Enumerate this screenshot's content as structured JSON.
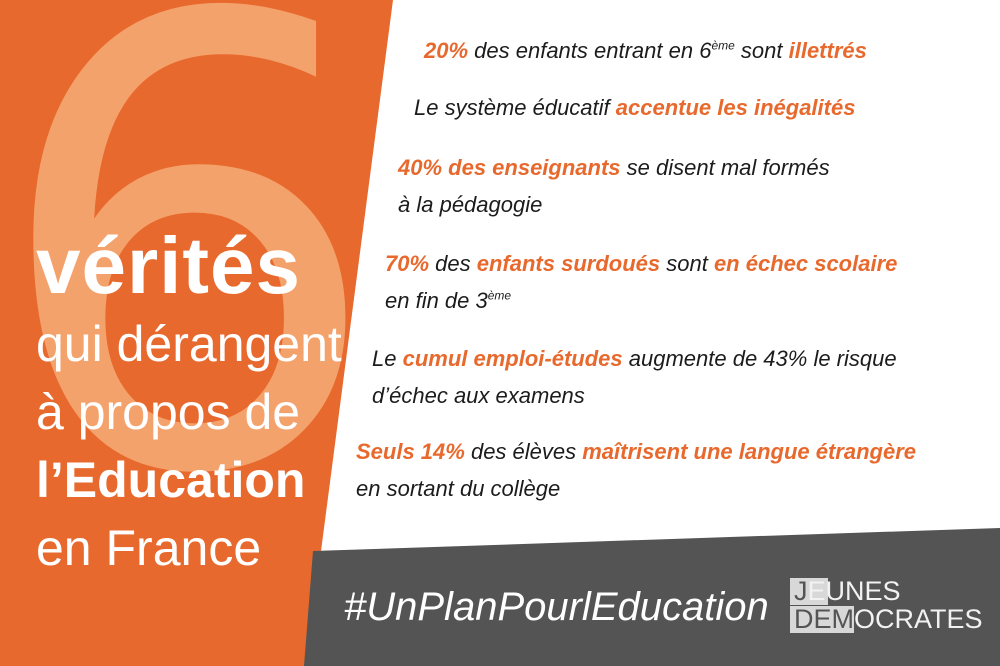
{
  "colors": {
    "orange": "#e8692d",
    "light_orange": "#f4a26c",
    "dark_grey": "#545454",
    "white": "#ffffff"
  },
  "big_number": "6",
  "left": {
    "line1": "vérités",
    "line2": "qui dérangent",
    "line3": "à propos de",
    "line4": "l’Education",
    "line5": "en France"
  },
  "facts": [
    {
      "parts": [
        {
          "t": "20%",
          "h": true
        },
        {
          "t": " des enfants entrant en 6"
        },
        {
          "t": "ème",
          "sup": true
        },
        {
          "t": " sont "
        },
        {
          "t": "illettrés",
          "h": true
        }
      ]
    },
    {
      "parts": [
        {
          "t": "Le système éducatif "
        },
        {
          "t": "accentue les inégalités",
          "h": true
        }
      ]
    },
    {
      "parts": [
        {
          "t": "40% des enseignants",
          "h": true
        },
        {
          "t": " se disent mal formés"
        },
        {
          "br": true
        },
        {
          "t": "à la pédagogie"
        }
      ]
    },
    {
      "parts": [
        {
          "t": "70%",
          "h": true
        },
        {
          "t": " des "
        },
        {
          "t": "enfants surdoués",
          "h": true
        },
        {
          "t": " sont "
        },
        {
          "t": "en échec scolaire",
          "h": true
        },
        {
          "br": true
        },
        {
          "t": "en fin de 3"
        },
        {
          "t": "ème",
          "sup": true
        }
      ]
    },
    {
      "parts": [
        {
          "t": "Le "
        },
        {
          "t": "cumul emploi-études",
          "h": true
        },
        {
          "t": " augmente de 43% le risque"
        },
        {
          "br": true
        },
        {
          "t": "d’échec aux examens"
        }
      ]
    },
    {
      "parts": [
        {
          "t": "Seuls 14%",
          "h": true
        },
        {
          "t": " des élèves "
        },
        {
          "t": "maîtrisent une langue étrangère",
          "h": true
        },
        {
          "br": true
        },
        {
          "t": "en sortant du collège"
        }
      ]
    }
  ],
  "hashtag": "#UnPlanPourlEducation",
  "logo": {
    "line1_a": "J",
    "line1_b": "EUNES",
    "line2_a": "DEM",
    "line2_b": "OCRATES"
  }
}
